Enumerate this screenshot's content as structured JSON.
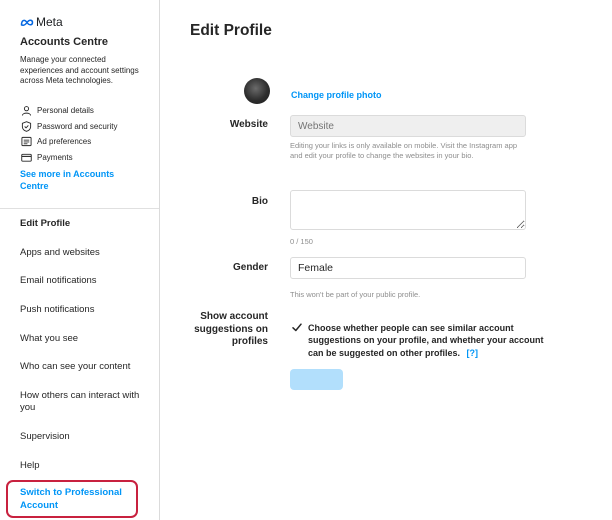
{
  "sidebar": {
    "logo_text": "Meta",
    "accounts_centre": {
      "title": "Accounts Centre",
      "description": "Manage your connected experiences and account settings across Meta technologies.",
      "links": [
        {
          "label": "Personal details",
          "icon": "person-icon"
        },
        {
          "label": "Password and security",
          "icon": "shield-icon"
        },
        {
          "label": "Ad preferences",
          "icon": "ad-icon"
        },
        {
          "label": "Payments",
          "icon": "credit-card-icon"
        }
      ],
      "see_more": "See more in Accounts Centre"
    },
    "nav": [
      {
        "label": "Edit Profile",
        "active": true
      },
      {
        "label": "Apps and websites"
      },
      {
        "label": "Email notifications"
      },
      {
        "label": "Push notifications"
      },
      {
        "label": "What you see"
      },
      {
        "label": "Who can see your content"
      },
      {
        "label": "How others can interact with you"
      },
      {
        "label": "Supervision"
      },
      {
        "label": "Help"
      }
    ],
    "switch_professional": "Switch to Professional Account",
    "highlight_color": "#c8213f"
  },
  "main": {
    "title": "Edit Profile",
    "profile": {
      "username": "",
      "change_photo": "Change profile photo"
    },
    "website": {
      "label": "Website",
      "placeholder": "Website",
      "help": "Editing your links is only available on mobile. Visit the Instagram app and edit your profile to change the websites in your bio."
    },
    "bio": {
      "label": "Bio",
      "value": "",
      "counter": "0 / 150"
    },
    "gender": {
      "label": "Gender",
      "value": "Female",
      "help": "This won't be part of your public profile."
    },
    "suggestions": {
      "label": "Show account suggestions on profiles",
      "checked": true,
      "text": "Choose whether people can see similar account suggestions on your profile, and whether your account can be suggested on other profiles.",
      "help_link": "[?]"
    },
    "submit_label": ""
  },
  "colors": {
    "accent": "#0095f6",
    "submit_disabled": "#b2dffc",
    "border": "#dbdbdb",
    "muted_text": "#8e8e8e"
  }
}
